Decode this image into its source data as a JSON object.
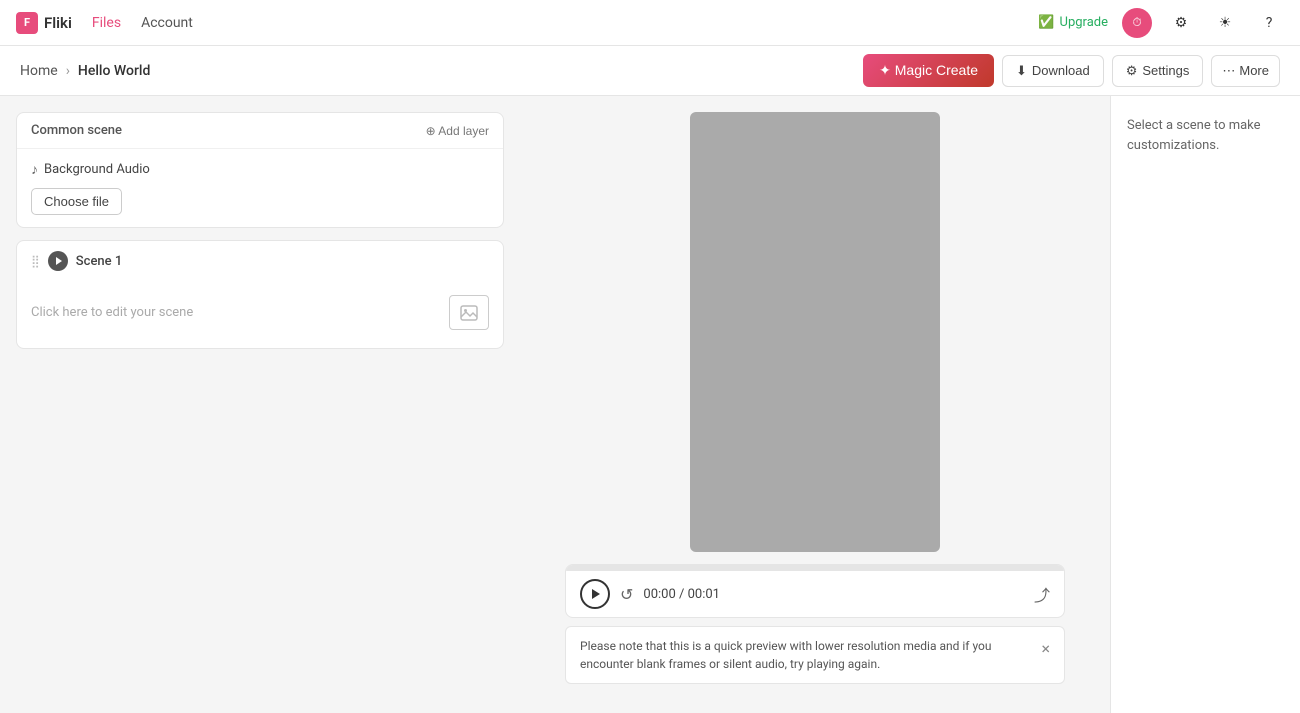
{
  "topnav": {
    "logo_label": "Fliki",
    "nav_files": "Files",
    "nav_account": "Account",
    "upgrade_label": "Upgrade",
    "timer_label": "⏱"
  },
  "breadcrumb": {
    "home": "Home",
    "separator": "›",
    "current": "Hello World"
  },
  "toolbar": {
    "magic_create": "✦ Magic Create",
    "download": "Download",
    "settings": "Settings",
    "more": "More"
  },
  "left_panel": {
    "common_scene_title": "Common scene",
    "add_layer_label": "⊕ Add layer",
    "bg_audio_label": "Background Audio",
    "choose_file_label": "Choose file",
    "scene1_title": "Scene 1",
    "scene1_placeholder": "Click here to edit your scene"
  },
  "player": {
    "time_current": "00:00",
    "time_total": "00:01",
    "time_separator": " / "
  },
  "notice": {
    "text": "Please note that this is a quick preview with lower resolution media and if you encounter blank frames or silent audio, try playing again."
  },
  "right_panel": {
    "text": "Select a scene to make customizations."
  }
}
